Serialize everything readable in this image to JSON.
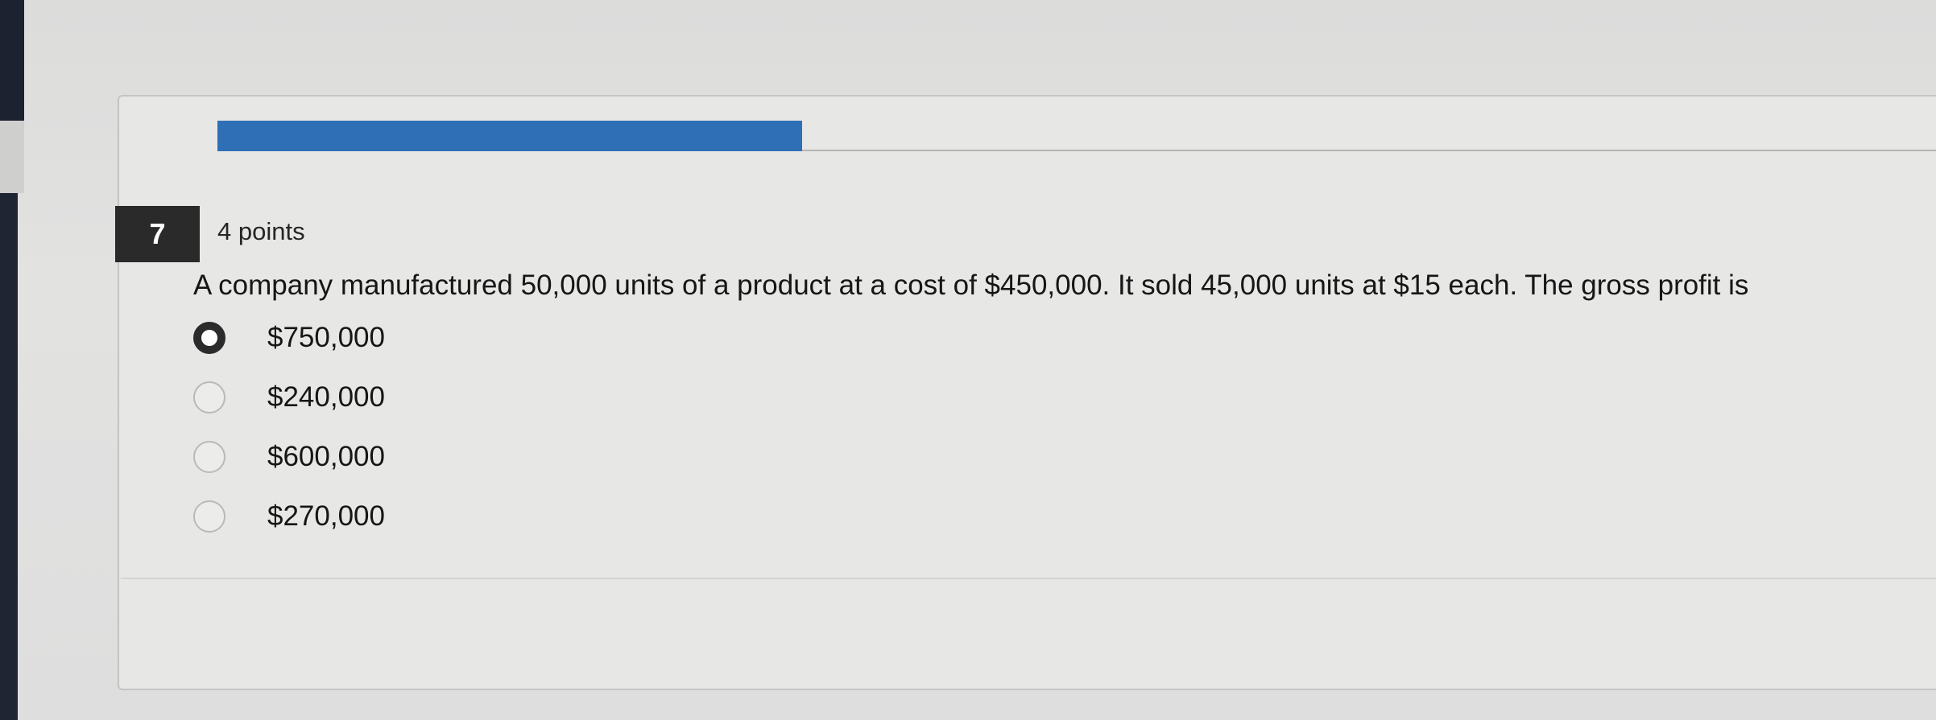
{
  "question": {
    "number": "7",
    "points": "4 points",
    "text": "A company manufactured 50,000 units of a product at a cost of $450,000. It sold 45,000 units at $15 each. The gross profit is",
    "progress": 0.34,
    "options": [
      {
        "label": "$750,000",
        "selected": true
      },
      {
        "label": "$240,000",
        "selected": false
      },
      {
        "label": "$600,000",
        "selected": false
      },
      {
        "label": "$270,000",
        "selected": false
      }
    ]
  },
  "colors": {
    "progress_bar": "#2f6fb5",
    "number_badge": "#2a2a2a"
  }
}
